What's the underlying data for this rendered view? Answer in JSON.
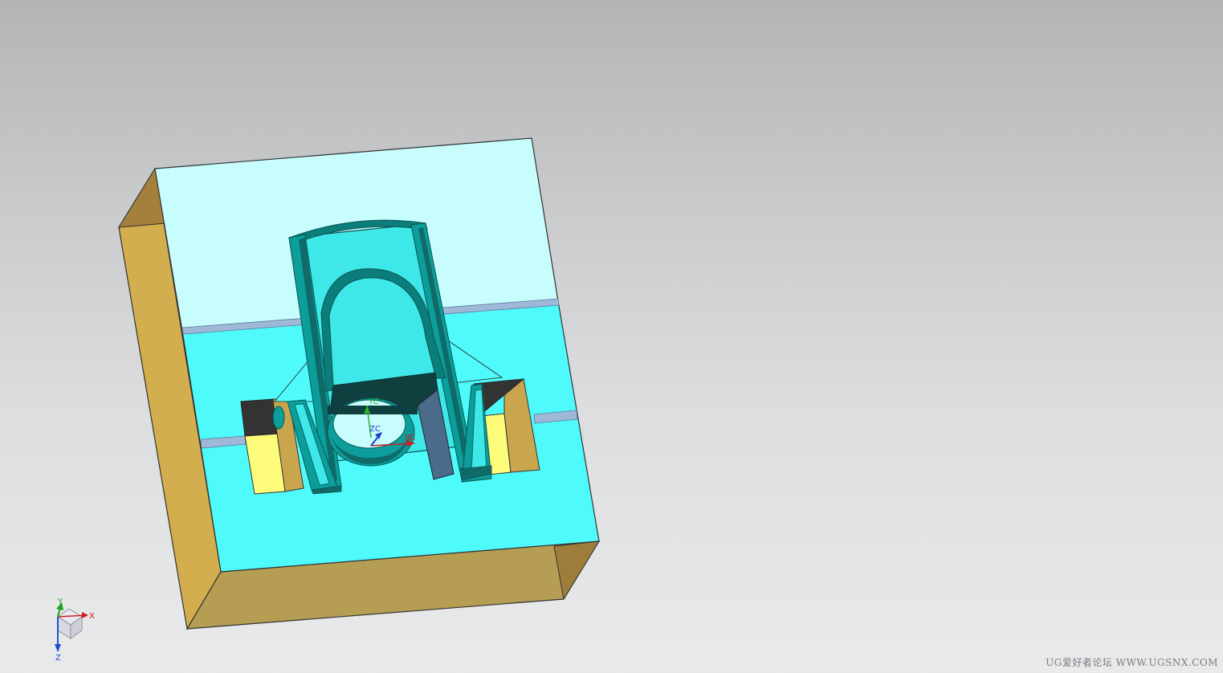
{
  "viewport": {
    "background_top": "#b2b4b6",
    "background_bottom": "#e9eaeb"
  },
  "model": {
    "colors": {
      "mold_top_light": "#c8fdfd",
      "mold_top_main": "#4ffafa",
      "mold_side_left": "#d2ae4f",
      "mold_side_bottom": "#b59d53",
      "mold_side_dark": "#9e7d3a",
      "core_cyan": "#3ee8e8",
      "core_dark": "#0b7d7a",
      "core_shadow": "#0f3f3f",
      "pocket_yellow": "#fcfc7a",
      "pocket_tan": "#c9a64e",
      "pocket_dark": "#333333",
      "slot_blue": "#4a6b8a",
      "parting_line": "#9fb8d8"
    }
  },
  "csys": {
    "yc": "YC",
    "xc": "XC",
    "zc": "ZC",
    "yc_color": "#2bb52b",
    "xc_color": "#d02020",
    "zc_color": "#2040d0"
  },
  "triad": {
    "x": "X",
    "y": "Y",
    "z": "Z",
    "x_color": "#d02020",
    "y_color": "#20a020",
    "z_color": "#2050d0"
  },
  "watermark": {
    "text": "UG爱好者论坛 WWW.UGSNX.COM"
  }
}
